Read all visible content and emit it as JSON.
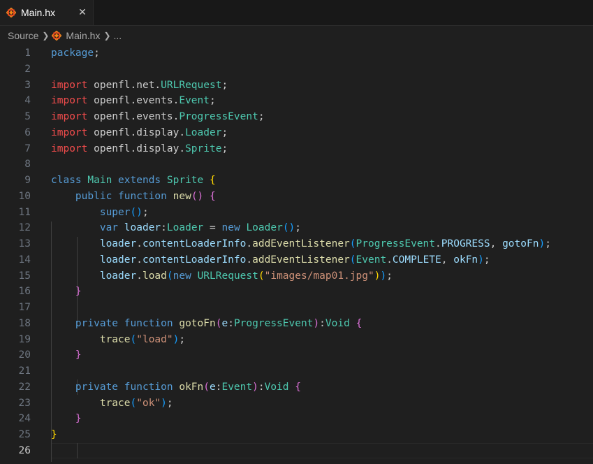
{
  "tab": {
    "title": "Main.hx",
    "close_glyph": "✕",
    "icon": "haxe-icon"
  },
  "breadcrumb": {
    "root": "Source",
    "file": "Main.hx",
    "more": "..."
  },
  "editor": {
    "active_line": 26,
    "lines": [
      {
        "n": "1",
        "tokens": [
          [
            "package",
            "kw-blue"
          ],
          [
            ";",
            "plain"
          ]
        ]
      },
      {
        "n": "2",
        "tokens": []
      },
      {
        "n": "3",
        "tokens": [
          [
            "import",
            "kw-red"
          ],
          [
            " openfl.net.",
            "plain"
          ],
          [
            "URLRequest",
            "type"
          ],
          [
            ";",
            "plain"
          ]
        ]
      },
      {
        "n": "4",
        "tokens": [
          [
            "import",
            "kw-red"
          ],
          [
            " openfl.events.",
            "plain"
          ],
          [
            "Event",
            "type"
          ],
          [
            ";",
            "plain"
          ]
        ]
      },
      {
        "n": "5",
        "tokens": [
          [
            "import",
            "kw-red"
          ],
          [
            " openfl.events.",
            "plain"
          ],
          [
            "ProgressEvent",
            "type"
          ],
          [
            ";",
            "plain"
          ]
        ]
      },
      {
        "n": "6",
        "tokens": [
          [
            "import",
            "kw-red"
          ],
          [
            " openfl.display.",
            "plain"
          ],
          [
            "Loader",
            "type"
          ],
          [
            ";",
            "plain"
          ]
        ]
      },
      {
        "n": "7",
        "tokens": [
          [
            "import",
            "kw-red"
          ],
          [
            " openfl.display.",
            "plain"
          ],
          [
            "Sprite",
            "type"
          ],
          [
            ";",
            "plain"
          ]
        ]
      },
      {
        "n": "8",
        "tokens": []
      },
      {
        "n": "9",
        "tokens": [
          [
            "class",
            "kw-blue"
          ],
          [
            " ",
            "plain"
          ],
          [
            "Main",
            "type"
          ],
          [
            " ",
            "plain"
          ],
          [
            "extends",
            "kw-blue"
          ],
          [
            " ",
            "plain"
          ],
          [
            "Sprite",
            "type"
          ],
          [
            " ",
            "plain"
          ],
          [
            "{",
            "br1"
          ]
        ]
      },
      {
        "n": "10",
        "tokens": [
          [
            "    ",
            "plain"
          ],
          [
            "public",
            "kw-blue"
          ],
          [
            " ",
            "plain"
          ],
          [
            "function",
            "kw-blue"
          ],
          [
            " ",
            "plain"
          ],
          [
            "new",
            "fn"
          ],
          [
            "()",
            "br2"
          ],
          [
            " ",
            "plain"
          ],
          [
            "{",
            "br2"
          ]
        ]
      },
      {
        "n": "11",
        "tokens": [
          [
            "        ",
            "plain"
          ],
          [
            "super",
            "kw-blue"
          ],
          [
            "()",
            "br3"
          ],
          [
            ";",
            "plain"
          ]
        ]
      },
      {
        "n": "12",
        "tokens": [
          [
            "        ",
            "plain"
          ],
          [
            "var",
            "kw-blue"
          ],
          [
            " ",
            "plain"
          ],
          [
            "loader",
            "var"
          ],
          [
            ":",
            "plain"
          ],
          [
            "Loader",
            "type"
          ],
          [
            " = ",
            "plain"
          ],
          [
            "new",
            "kw-blue"
          ],
          [
            " ",
            "plain"
          ],
          [
            "Loader",
            "type"
          ],
          [
            "()",
            "br3"
          ],
          [
            ";",
            "plain"
          ]
        ]
      },
      {
        "n": "13",
        "tokens": [
          [
            "        ",
            "plain"
          ],
          [
            "loader",
            "var"
          ],
          [
            ".",
            "plain"
          ],
          [
            "contentLoaderInfo",
            "var"
          ],
          [
            ".",
            "plain"
          ],
          [
            "addEventListener",
            "fn"
          ],
          [
            "(",
            "br3"
          ],
          [
            "ProgressEvent",
            "type"
          ],
          [
            ".",
            "plain"
          ],
          [
            "PROGRESS",
            "var"
          ],
          [
            ", ",
            "plain"
          ],
          [
            "gotoFn",
            "var"
          ],
          [
            ")",
            "br3"
          ],
          [
            ";",
            "plain"
          ]
        ]
      },
      {
        "n": "14",
        "tokens": [
          [
            "        ",
            "plain"
          ],
          [
            "loader",
            "var"
          ],
          [
            ".",
            "plain"
          ],
          [
            "contentLoaderInfo",
            "var"
          ],
          [
            ".",
            "plain"
          ],
          [
            "addEventListener",
            "fn"
          ],
          [
            "(",
            "br3"
          ],
          [
            "Event",
            "type"
          ],
          [
            ".",
            "plain"
          ],
          [
            "COMPLETE",
            "var"
          ],
          [
            ", ",
            "plain"
          ],
          [
            "okFn",
            "var"
          ],
          [
            ")",
            "br3"
          ],
          [
            ";",
            "plain"
          ]
        ]
      },
      {
        "n": "15",
        "tokens": [
          [
            "        ",
            "plain"
          ],
          [
            "loader",
            "var"
          ],
          [
            ".",
            "plain"
          ],
          [
            "load",
            "fn"
          ],
          [
            "(",
            "br3"
          ],
          [
            "new",
            "kw-blue"
          ],
          [
            " ",
            "plain"
          ],
          [
            "URLRequest",
            "type"
          ],
          [
            "(",
            "br1"
          ],
          [
            "\"images/map01.jpg\"",
            "str"
          ],
          [
            ")",
            "br1"
          ],
          [
            ")",
            "br3"
          ],
          [
            ";",
            "plain"
          ]
        ]
      },
      {
        "n": "16",
        "tokens": [
          [
            "    ",
            "plain"
          ],
          [
            "}",
            "br2"
          ]
        ]
      },
      {
        "n": "17",
        "tokens": []
      },
      {
        "n": "18",
        "tokens": [
          [
            "    ",
            "plain"
          ],
          [
            "private",
            "kw-blue"
          ],
          [
            " ",
            "plain"
          ],
          [
            "function",
            "kw-blue"
          ],
          [
            " ",
            "plain"
          ],
          [
            "gotoFn",
            "fn"
          ],
          [
            "(",
            "br2"
          ],
          [
            "e",
            "var"
          ],
          [
            ":",
            "plain"
          ],
          [
            "ProgressEvent",
            "type"
          ],
          [
            ")",
            "br2"
          ],
          [
            ":",
            "plain"
          ],
          [
            "Void",
            "type"
          ],
          [
            " ",
            "plain"
          ],
          [
            "{",
            "br2"
          ]
        ]
      },
      {
        "n": "19",
        "tokens": [
          [
            "        ",
            "plain"
          ],
          [
            "trace",
            "fn"
          ],
          [
            "(",
            "br3"
          ],
          [
            "\"load\"",
            "str"
          ],
          [
            ")",
            "br3"
          ],
          [
            ";",
            "plain"
          ]
        ]
      },
      {
        "n": "20",
        "tokens": [
          [
            "    ",
            "plain"
          ],
          [
            "}",
            "br2"
          ]
        ]
      },
      {
        "n": "21",
        "tokens": []
      },
      {
        "n": "22",
        "tokens": [
          [
            "    ",
            "plain"
          ],
          [
            "private",
            "kw-blue"
          ],
          [
            " ",
            "plain"
          ],
          [
            "function",
            "kw-blue"
          ],
          [
            " ",
            "plain"
          ],
          [
            "okFn",
            "fn"
          ],
          [
            "(",
            "br2"
          ],
          [
            "e",
            "var"
          ],
          [
            ":",
            "plain"
          ],
          [
            "Event",
            "type"
          ],
          [
            ")",
            "br2"
          ],
          [
            ":",
            "plain"
          ],
          [
            "Void",
            "type"
          ],
          [
            " ",
            "plain"
          ],
          [
            "{",
            "br2"
          ]
        ]
      },
      {
        "n": "23",
        "tokens": [
          [
            "        ",
            "plain"
          ],
          [
            "trace",
            "fn"
          ],
          [
            "(",
            "br3"
          ],
          [
            "\"ok\"",
            "str"
          ],
          [
            ")",
            "br3"
          ],
          [
            ";",
            "plain"
          ]
        ]
      },
      {
        "n": "24",
        "tokens": [
          [
            "    ",
            "plain"
          ],
          [
            "}",
            "br2"
          ]
        ]
      },
      {
        "n": "25",
        "tokens": [
          [
            "}",
            "br1"
          ]
        ]
      },
      {
        "n": "26",
        "tokens": []
      }
    ]
  }
}
